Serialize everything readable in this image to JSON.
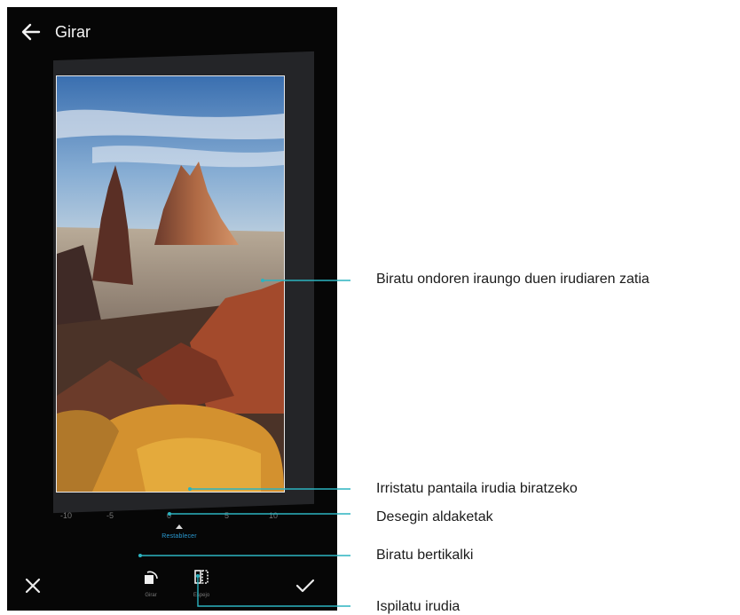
{
  "header": {
    "title": "Girar"
  },
  "toolbar": {
    "undo_label": "Restablecer",
    "rotate_label": "Girar",
    "mirror_label": "Espejo"
  },
  "dial": {
    "ticks": [
      "-10",
      "-5",
      "0",
      "5",
      "10"
    ]
  },
  "annotations": {
    "cropped_area": "Biratu ondoren iraungo duen irudiaren zatia",
    "swipe_to_rotate": "Irristatu pantaila irudia biratzeko",
    "undo_changes": "Desegin aldaketak",
    "rotate_vertical": "Biratu bertikalki",
    "mirror_image": "Ispilatu irudia"
  },
  "colors": {
    "phone_background": "#060606",
    "callout_line": "#2bb3c0",
    "undo_accent": "#2a9bd3"
  }
}
